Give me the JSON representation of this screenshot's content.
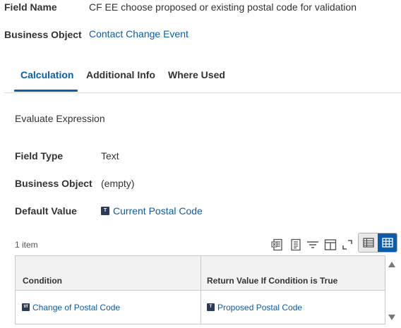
{
  "header": {
    "field_name_label": "Field Name",
    "field_name_value": "CF EE choose proposed or existing postal code for validation",
    "business_object_label": "Business Object",
    "business_object_value": "Contact Change Event"
  },
  "tabs": [
    {
      "label": "Calculation",
      "active": true
    },
    {
      "label": "Additional Info",
      "active": false
    },
    {
      "label": "Where Used",
      "active": false
    }
  ],
  "calculation": {
    "type": "Evaluate Expression",
    "field_type_label": "Field Type",
    "field_type_value": "Text",
    "business_object_label": "Business Object",
    "business_object_value": "(empty)",
    "default_value_label": "Default Value",
    "default_value_value": "Current Postal Code",
    "default_value_icon": "T"
  },
  "grid": {
    "item_count": "1 item",
    "toolbar_icons": [
      "excel-export-icon",
      "pdf-export-icon",
      "filter-icon",
      "column-chooser-icon",
      "fullscreen-icon"
    ],
    "columns": [
      "Condition",
      "Return Value If Condition is True"
    ],
    "rows": [
      {
        "condition": "Change of Postal Code",
        "condition_icon": "t/f",
        "return_value": "Proposed Postal Code",
        "return_icon": "T"
      }
    ]
  },
  "colors": {
    "accent": "#0b5cab",
    "icon_bg": "#2b3a57",
    "text": "#333333"
  }
}
